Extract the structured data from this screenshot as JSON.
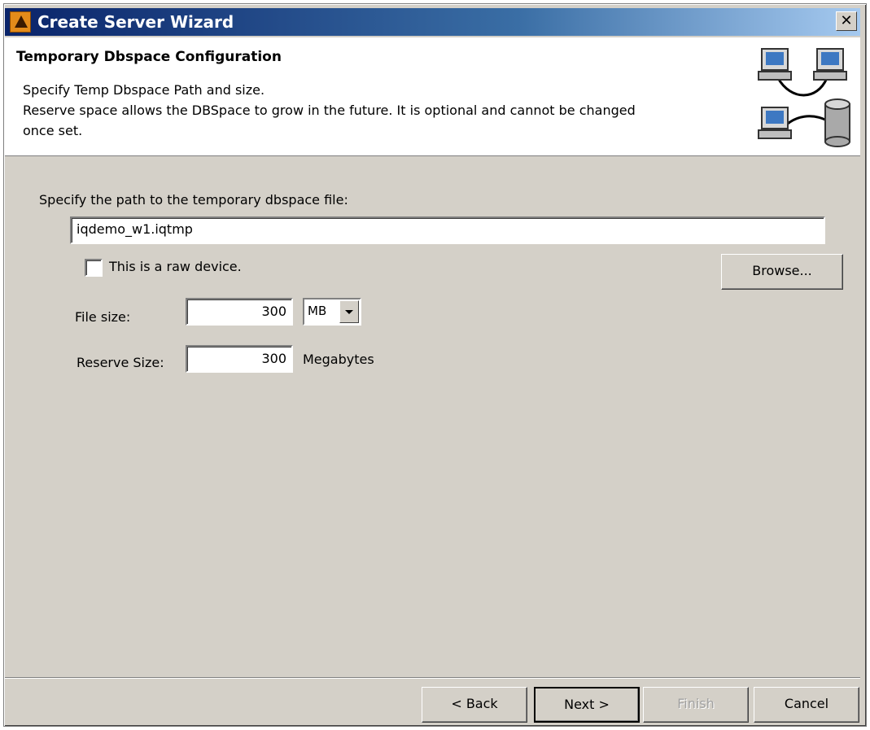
{
  "window": {
    "title": "Create Server Wizard",
    "close_glyph": "✕"
  },
  "header": {
    "title": "Temporary Dbspace Configuration",
    "desc_line1": "Specify Temp Dbspace Path and size.",
    "desc_line2": "Reserve space allows the DBSpace to grow in the future.  It is optional and cannot be changed",
    "desc_line3": "once set."
  },
  "form": {
    "path_label": "Specify the path to the temporary dbspace file:",
    "path_value": "iqdemo_w1.iqtmp",
    "raw_device_label": "This is a raw device.",
    "raw_device_checked": false,
    "browse_label": "Browse...",
    "file_size_label": "File size:",
    "file_size_value": "300",
    "file_size_unit": "MB",
    "reserve_size_label": "Reserve Size:",
    "reserve_size_value": "300",
    "reserve_size_unit": "Megabytes"
  },
  "footer": {
    "back_label": "< Back",
    "next_label": "Next >",
    "finish_label": "Finish",
    "cancel_label": "Cancel"
  },
  "icons": {
    "app": "sybase-central-icon",
    "graphic": "network-computers-database-icon"
  }
}
